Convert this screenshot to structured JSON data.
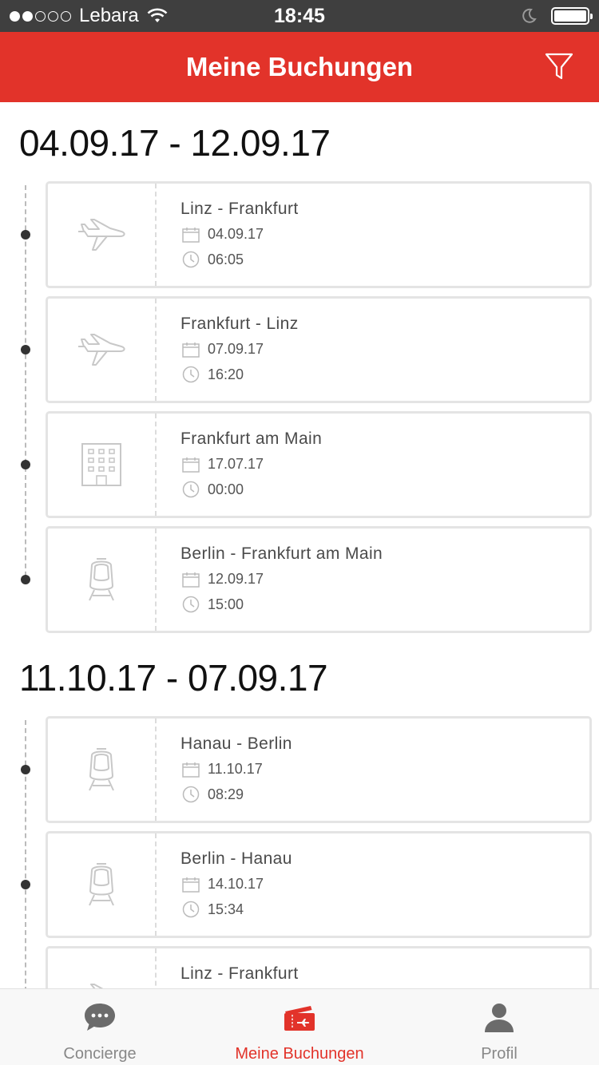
{
  "status_bar": {
    "carrier": "Lebara",
    "time": "18:45",
    "signal_bars_filled": 2,
    "signal_bars_total": 5
  },
  "header": {
    "title": "Meine Buchungen",
    "filter_icon": "filter-icon"
  },
  "colors": {
    "brand_red": "#e2332a",
    "status_bar": "#3f3f3f",
    "icon_gray": "#c8c8c8"
  },
  "groups": [
    {
      "range": "04.09.17 - 12.09.17",
      "bookings": [
        {
          "type": "flight",
          "icon": "airplane-icon",
          "title": "Linz - Frankfurt",
          "date": "04.09.17",
          "time": "06:05"
        },
        {
          "type": "flight",
          "icon": "airplane-icon",
          "title": "Frankfurt - Linz",
          "date": "07.09.17",
          "time": "16:20"
        },
        {
          "type": "hotel",
          "icon": "hotel-building-icon",
          "title": "Frankfurt am Main",
          "date": "17.07.17",
          "time": "00:00"
        },
        {
          "type": "train",
          "icon": "train-icon",
          "title": "Berlin - Frankfurt am Main",
          "date": "12.09.17",
          "time": "15:00"
        }
      ]
    },
    {
      "range": "11.10.17 - 07.09.17",
      "bookings": [
        {
          "type": "train",
          "icon": "train-icon",
          "title": "Hanau - Berlin",
          "date": "11.10.17",
          "time": "08:29"
        },
        {
          "type": "train",
          "icon": "train-icon",
          "title": "Berlin - Hanau",
          "date": "14.10.17",
          "time": "15:34"
        },
        {
          "type": "flight",
          "icon": "airplane-icon",
          "title": "Linz - Frankfurt",
          "date": "",
          "time": ""
        }
      ]
    }
  ],
  "tabbar": {
    "tabs": [
      {
        "label": "Concierge",
        "icon": "chat-bubble-icon",
        "active": false
      },
      {
        "label": "Meine Buchungen",
        "icon": "ticket-icon",
        "active": true
      },
      {
        "label": "Profil",
        "icon": "person-icon",
        "active": false
      }
    ]
  }
}
